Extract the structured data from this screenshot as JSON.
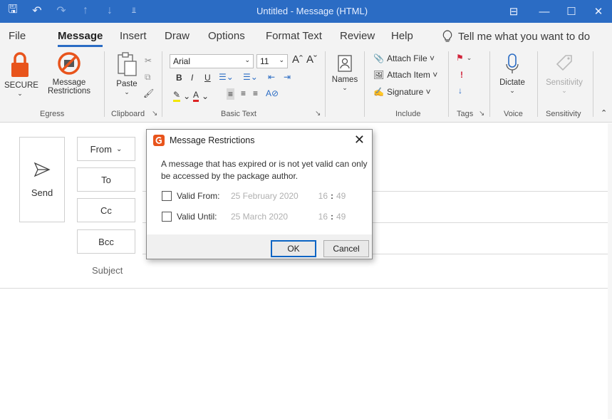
{
  "window": {
    "title": "Untitled  -  Message (HTML)",
    "accent": "#2b6cc4"
  },
  "tabs": [
    "File",
    "Message",
    "Insert",
    "Draw",
    "Options",
    "Format Text",
    "Review",
    "Help"
  ],
  "active_tab": "Message",
  "tell_me": "Tell me what you want to do",
  "ribbon": {
    "egress": {
      "secure_label": "SECURE",
      "restrictions_line1": "Message",
      "restrictions_line2": "Restrictions",
      "group_label": "Egress"
    },
    "clipboard": {
      "paste_label": "Paste",
      "group_label": "Clipboard"
    },
    "basic_text": {
      "font": "Arial",
      "size": "11",
      "group_label": "Basic Text"
    },
    "names": {
      "label": "Names"
    },
    "include": {
      "attach_file": "Attach File ˅",
      "attach_item": "Attach Item ˅",
      "signature": "Signature ˅",
      "group_label": "Include"
    },
    "tags": {
      "group_label": "Tags"
    },
    "voice": {
      "dictate": "Dictate",
      "group_label": "Voice"
    },
    "sensitivity": {
      "label": "Sensitivity",
      "group_label": "Sensitivity"
    }
  },
  "compose": {
    "send_label": "Send",
    "from_label": "From",
    "to_label": "To",
    "cc_label": "Cc",
    "bcc_label": "Bcc",
    "subject_placeholder": "Subject"
  },
  "dialog": {
    "title": "Message Restrictions",
    "message": "A message that has expired or is not yet valid can only be accessed by the package author.",
    "valid_from": {
      "label": "Valid From:",
      "date": "25 February 2020",
      "hour": "16",
      "minute": "49",
      "checked": false
    },
    "valid_until": {
      "label": "Valid Until:",
      "date": "25 March 2020",
      "hour": "16",
      "minute": "49",
      "checked": false
    },
    "ok_label": "OK",
    "cancel_label": "Cancel"
  }
}
